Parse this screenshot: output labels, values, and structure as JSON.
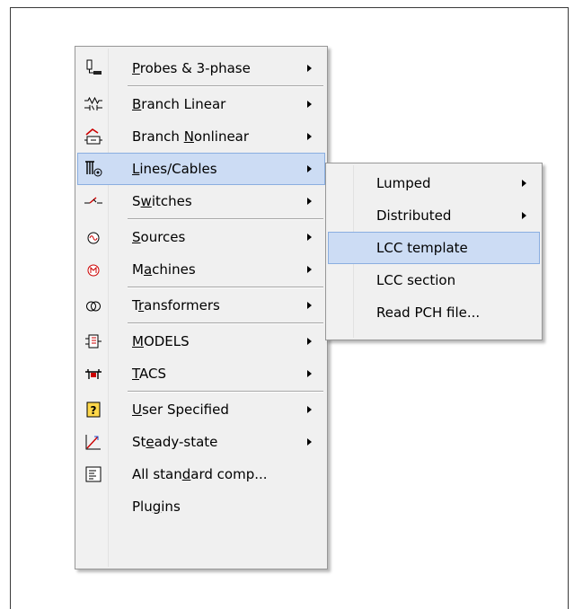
{
  "main_menu": {
    "items": [
      {
        "pre": "",
        "key": "P",
        "post": "robes & 3-phase",
        "icon": "probe-icon",
        "submenu": true
      },
      {
        "pre": "",
        "key": "B",
        "post": "ranch Linear",
        "icon": "resistor-icon",
        "submenu": true
      },
      {
        "pre": "Branch ",
        "key": "N",
        "post": "onlinear",
        "icon": "nonlinear-branch-icon",
        "submenu": true
      },
      {
        "pre": "",
        "key": "L",
        "post": "ines/Cables",
        "icon": "line-cable-icon",
        "submenu": true
      },
      {
        "pre": "S",
        "key": "w",
        "post": "itches",
        "icon": "switch-icon",
        "submenu": true
      },
      {
        "pre": "",
        "key": "S",
        "post": "ources",
        "icon": "source-icon",
        "submenu": true
      },
      {
        "pre": "M",
        "key": "a",
        "post": "chines",
        "icon": "machine-icon",
        "submenu": true
      },
      {
        "pre": "T",
        "key": "r",
        "post": "ansformers",
        "icon": "transformer-icon",
        "submenu": true
      },
      {
        "pre": "",
        "key": "M",
        "post": "ODELS",
        "icon": "models-icon",
        "submenu": true
      },
      {
        "pre": "",
        "key": "T",
        "post": "ACS",
        "icon": "tacs-icon",
        "submenu": true
      },
      {
        "pre": "",
        "key": "U",
        "post": "ser Specified",
        "icon": "user-specified-icon",
        "submenu": true
      },
      {
        "pre": "St",
        "key": "e",
        "post": "ady-state",
        "icon": "steady-state-icon",
        "submenu": true
      },
      {
        "pre": "All stan",
        "key": "d",
        "post": "ard comp...",
        "icon": "component-list-icon",
        "submenu": false
      },
      {
        "pre": "Plu",
        "key": "g",
        "post": "ins",
        "icon": "",
        "submenu": false
      }
    ]
  },
  "sub_menu": {
    "items": [
      {
        "label": "Lumped",
        "submenu": true
      },
      {
        "label": "Distributed",
        "submenu": true
      },
      {
        "label": "LCC template",
        "submenu": false
      },
      {
        "label": "LCC section",
        "submenu": false
      },
      {
        "label": "Read PCH file...",
        "submenu": false
      }
    ]
  },
  "colors": {
    "highlight": "#ccdcf4",
    "highlight_border": "#8aaee0",
    "menu_bg": "#f0f0f0"
  }
}
